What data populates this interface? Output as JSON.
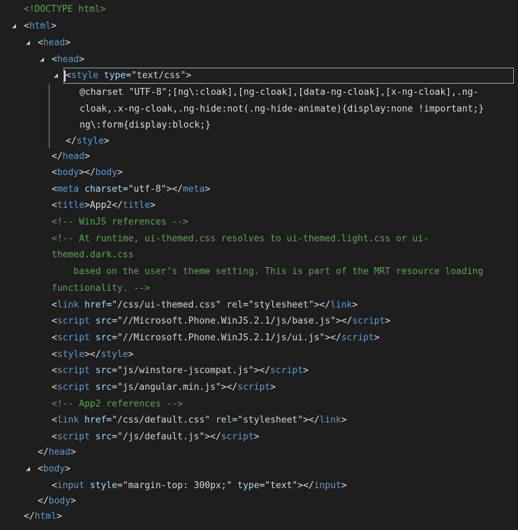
{
  "lines": [
    {
      "name": "doctype-node",
      "expander": "",
      "segments": [
        {
          "t": "doctype",
          "v": "<!DOCTYPE html>"
        }
      ]
    },
    {
      "name": "html-node",
      "expander": "collapse-triangle",
      "segments": [
        {
          "t": "punct",
          "v": "<"
        },
        {
          "t": "tag",
          "v": "html"
        },
        {
          "t": "punct",
          "v": ">"
        }
      ]
    },
    {
      "name": "head-node-outer",
      "expander": "collapse-triangle",
      "segments": [
        {
          "t": "punct",
          "v": "<"
        },
        {
          "t": "tag",
          "v": "head"
        },
        {
          "t": "punct",
          "v": ">"
        }
      ]
    },
    {
      "name": "head-node-inner",
      "expander": "collapse-triangle",
      "segments": [
        {
          "t": "punct",
          "v": "<"
        },
        {
          "t": "tag",
          "v": "head"
        },
        {
          "t": "punct",
          "v": ">"
        }
      ]
    },
    {
      "name": "style-node-selected",
      "expander": "collapse-triangle",
      "segments": [
        {
          "t": "punct",
          "v": "<"
        },
        {
          "t": "tag",
          "v": "style"
        },
        {
          "t": "punct",
          "v": " "
        },
        {
          "t": "attr",
          "v": "type"
        },
        {
          "t": "punct",
          "v": "="
        },
        {
          "t": "value",
          "v": "\"text/css\""
        },
        {
          "t": "punct",
          "v": ">"
        }
      ]
    },
    {
      "name": "style-text-line-1",
      "expander": "",
      "segments": [
        {
          "t": "text",
          "v": "@charset \"UTF-8\";[ng\\:cloak],[ng-cloak],[data-ng-cloak],[x-ng-cloak],.ng-"
        }
      ]
    },
    {
      "name": "style-text-line-2",
      "expander": "",
      "segments": [
        {
          "t": "text",
          "v": "cloak,.x-ng-cloak,.ng-hide:not(.ng-hide-animate){display:none !important;}"
        }
      ]
    },
    {
      "name": "style-text-line-3",
      "expander": "",
      "segments": [
        {
          "t": "text",
          "v": "ng\\:form{display:block;}"
        }
      ]
    },
    {
      "name": "style-close-tag",
      "expander": "",
      "segments": [
        {
          "t": "punct",
          "v": "</"
        },
        {
          "t": "tag",
          "v": "style"
        },
        {
          "t": "punct",
          "v": ">"
        }
      ]
    },
    {
      "name": "head-inner-close-tag",
      "expander": "",
      "segments": [
        {
          "t": "punct",
          "v": "</"
        },
        {
          "t": "tag",
          "v": "head"
        },
        {
          "t": "punct",
          "v": ">"
        }
      ]
    },
    {
      "name": "body-empty-node",
      "expander": "",
      "segments": [
        {
          "t": "punct",
          "v": "<"
        },
        {
          "t": "tag",
          "v": "body"
        },
        {
          "t": "punct",
          "v": "></"
        },
        {
          "t": "tag",
          "v": "body"
        },
        {
          "t": "punct",
          "v": ">"
        }
      ]
    },
    {
      "name": "meta-node",
      "expander": "",
      "segments": [
        {
          "t": "punct",
          "v": "<"
        },
        {
          "t": "tag",
          "v": "meta"
        },
        {
          "t": "punct",
          "v": " "
        },
        {
          "t": "attr",
          "v": "charset"
        },
        {
          "t": "punct",
          "v": "="
        },
        {
          "t": "value",
          "v": "\"utf-8\""
        },
        {
          "t": "punct",
          "v": "></"
        },
        {
          "t": "tag",
          "v": "meta"
        },
        {
          "t": "punct",
          "v": ">"
        }
      ]
    },
    {
      "name": "title-node",
      "expander": "",
      "segments": [
        {
          "t": "punct",
          "v": "<"
        },
        {
          "t": "tag",
          "v": "title"
        },
        {
          "t": "punct",
          "v": ">"
        },
        {
          "t": "text",
          "v": "App2"
        },
        {
          "t": "punct",
          "v": "</"
        },
        {
          "t": "tag",
          "v": "title"
        },
        {
          "t": "punct",
          "v": ">"
        }
      ]
    },
    {
      "name": "comment-winjs",
      "expander": "",
      "segments": [
        {
          "t": "comment",
          "v": "<!-- WinJS references -->"
        }
      ]
    },
    {
      "name": "comment-runtime-line-1",
      "expander": "",
      "segments": [
        {
          "t": "comment",
          "v": "<!-- At runtime, ui-themed.css resolves to ui-themed.light.css or ui-"
        }
      ]
    },
    {
      "name": "comment-runtime-line-2",
      "expander": "",
      "segments": [
        {
          "t": "comment",
          "v": "themed.dark.css"
        }
      ]
    },
    {
      "name": "comment-runtime-line-3",
      "expander": "",
      "segments": [
        {
          "t": "comment",
          "v": "    based on the user’s theme setting. This is part of the MRT resource loading"
        }
      ]
    },
    {
      "name": "comment-runtime-line-4",
      "expander": "",
      "segments": [
        {
          "t": "comment",
          "v": "functionality. -->"
        }
      ]
    },
    {
      "name": "link-ui-themed-node",
      "expander": "",
      "segments": [
        {
          "t": "punct",
          "v": "<"
        },
        {
          "t": "tag",
          "v": "link"
        },
        {
          "t": "punct",
          "v": " "
        },
        {
          "t": "attr",
          "v": "href"
        },
        {
          "t": "punct",
          "v": "="
        },
        {
          "t": "value",
          "v": "\"/css/ui-themed.css\""
        },
        {
          "t": "punct",
          "v": " "
        },
        {
          "t": "attr",
          "v": "rel"
        },
        {
          "t": "punct",
          "v": "="
        },
        {
          "t": "value",
          "v": "\"stylesheet\""
        },
        {
          "t": "punct",
          "v": "></"
        },
        {
          "t": "tag",
          "v": "link"
        },
        {
          "t": "punct",
          "v": ">"
        }
      ]
    },
    {
      "name": "script-base-node",
      "expander": "",
      "segments": [
        {
          "t": "punct",
          "v": "<"
        },
        {
          "t": "tag",
          "v": "script"
        },
        {
          "t": "punct",
          "v": " "
        },
        {
          "t": "attr",
          "v": "src"
        },
        {
          "t": "punct",
          "v": "="
        },
        {
          "t": "value",
          "v": "\"//Microsoft.Phone.WinJS.2.1/js/base.js\""
        },
        {
          "t": "punct",
          "v": "></"
        },
        {
          "t": "tag",
          "v": "script"
        },
        {
          "t": "punct",
          "v": ">"
        }
      ]
    },
    {
      "name": "script-ui-node",
      "expander": "",
      "segments": [
        {
          "t": "punct",
          "v": "<"
        },
        {
          "t": "tag",
          "v": "script"
        },
        {
          "t": "punct",
          "v": " "
        },
        {
          "t": "attr",
          "v": "src"
        },
        {
          "t": "punct",
          "v": "="
        },
        {
          "t": "value",
          "v": "\"//Microsoft.Phone.WinJS.2.1/js/ui.js\""
        },
        {
          "t": "punct",
          "v": "></"
        },
        {
          "t": "tag",
          "v": "script"
        },
        {
          "t": "punct",
          "v": ">"
        }
      ]
    },
    {
      "name": "style-empty-node",
      "expander": "",
      "segments": [
        {
          "t": "punct",
          "v": "<"
        },
        {
          "t": "tag",
          "v": "style"
        },
        {
          "t": "punct",
          "v": "></"
        },
        {
          "t": "tag",
          "v": "style"
        },
        {
          "t": "punct",
          "v": ">"
        }
      ]
    },
    {
      "name": "script-jscompat-node",
      "expander": "",
      "segments": [
        {
          "t": "punct",
          "v": "<"
        },
        {
          "t": "tag",
          "v": "script"
        },
        {
          "t": "punct",
          "v": " "
        },
        {
          "t": "attr",
          "v": "src"
        },
        {
          "t": "punct",
          "v": "="
        },
        {
          "t": "value",
          "v": "\"js/winstore-jscompat.js\""
        },
        {
          "t": "punct",
          "v": "></"
        },
        {
          "t": "tag",
          "v": "script"
        },
        {
          "t": "punct",
          "v": ">"
        }
      ]
    },
    {
      "name": "script-angular-node",
      "expander": "",
      "segments": [
        {
          "t": "punct",
          "v": "<"
        },
        {
          "t": "tag",
          "v": "script"
        },
        {
          "t": "punct",
          "v": " "
        },
        {
          "t": "attr",
          "v": "src"
        },
        {
          "t": "punct",
          "v": "="
        },
        {
          "t": "value",
          "v": "\"js/angular.min.js\""
        },
        {
          "t": "punct",
          "v": "></"
        },
        {
          "t": "tag",
          "v": "script"
        },
        {
          "t": "punct",
          "v": ">"
        }
      ]
    },
    {
      "name": "comment-app2",
      "expander": "",
      "segments": [
        {
          "t": "comment",
          "v": "<!-- App2 references -->"
        }
      ]
    },
    {
      "name": "link-default-node",
      "expander": "",
      "segments": [
        {
          "t": "punct",
          "v": "<"
        },
        {
          "t": "tag",
          "v": "link"
        },
        {
          "t": "punct",
          "v": " "
        },
        {
          "t": "attr",
          "v": "href"
        },
        {
          "t": "punct",
          "v": "="
        },
        {
          "t": "value",
          "v": "\"/css/default.css\""
        },
        {
          "t": "punct",
          "v": " "
        },
        {
          "t": "attr",
          "v": "rel"
        },
        {
          "t": "punct",
          "v": "="
        },
        {
          "t": "value",
          "v": "\"stylesheet\""
        },
        {
          "t": "punct",
          "v": "></"
        },
        {
          "t": "tag",
          "v": "link"
        },
        {
          "t": "punct",
          "v": ">"
        }
      ]
    },
    {
      "name": "script-default-node",
      "expander": "",
      "segments": [
        {
          "t": "punct",
          "v": "<"
        },
        {
          "t": "tag",
          "v": "script"
        },
        {
          "t": "punct",
          "v": " "
        },
        {
          "t": "attr",
          "v": "src"
        },
        {
          "t": "punct",
          "v": "="
        },
        {
          "t": "value",
          "v": "\"/js/default.js\""
        },
        {
          "t": "punct",
          "v": "></"
        },
        {
          "t": "tag",
          "v": "script"
        },
        {
          "t": "punct",
          "v": ">"
        }
      ]
    },
    {
      "name": "head-outer-close-tag",
      "expander": "",
      "segments": [
        {
          "t": "punct",
          "v": "</"
        },
        {
          "t": "tag",
          "v": "head"
        },
        {
          "t": "punct",
          "v": ">"
        }
      ]
    },
    {
      "name": "body-node",
      "expander": "collapse-triangle",
      "segments": [
        {
          "t": "punct",
          "v": "<"
        },
        {
          "t": "tag",
          "v": "body"
        },
        {
          "t": "punct",
          "v": ">"
        }
      ]
    },
    {
      "name": "input-node",
      "expander": "",
      "segments": [
        {
          "t": "punct",
          "v": "<"
        },
        {
          "t": "tag",
          "v": "input"
        },
        {
          "t": "punct",
          "v": " "
        },
        {
          "t": "attr",
          "v": "style"
        },
        {
          "t": "punct",
          "v": "="
        },
        {
          "t": "value",
          "v": "\"margin-top: 300px;\""
        },
        {
          "t": "punct",
          "v": " "
        },
        {
          "t": "attr",
          "v": "type"
        },
        {
          "t": "punct",
          "v": "="
        },
        {
          "t": "value",
          "v": "\"text\""
        },
        {
          "t": "punct",
          "v": "></"
        },
        {
          "t": "tag",
          "v": "input"
        },
        {
          "t": "punct",
          "v": ">"
        }
      ]
    },
    {
      "name": "body-close-tag",
      "expander": "",
      "segments": [
        {
          "t": "punct",
          "v": "</"
        },
        {
          "t": "tag",
          "v": "body"
        },
        {
          "t": "punct",
          "v": ">"
        }
      ]
    },
    {
      "name": "html-close-tag",
      "expander": "",
      "segments": [
        {
          "t": "punct",
          "v": "</"
        },
        {
          "t": "tag",
          "v": "html"
        },
        {
          "t": "punct",
          "v": ">"
        }
      ]
    }
  ],
  "theme": {
    "background": "#1e1e1e",
    "tag": "#569cd6",
    "attr": "#9cdcfe",
    "value": "#d4d4d4",
    "comment": "#57a64a",
    "text": "#dcdcdc"
  }
}
